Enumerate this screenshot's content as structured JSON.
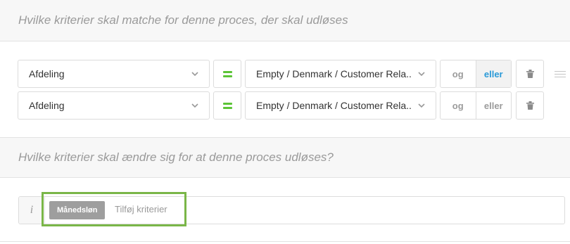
{
  "section_match": {
    "title": "Hvilke kriterier skal matche for denne proces, der skal udløses"
  },
  "rules": [
    {
      "field": "Afdeling",
      "operator": "=",
      "value": "Empty / Denmark / Customer Rela...",
      "and_label": "og",
      "or_label": "eller",
      "active": "eller"
    },
    {
      "field": "Afdeling",
      "operator": "=",
      "value": "Empty / Denmark / Customer Rela...",
      "and_label": "og",
      "or_label": "eller",
      "active": "none"
    }
  ],
  "section_change": {
    "title": "Hvilke kriterier skal ændre sig for at denne proces udløses?"
  },
  "criteria_bar": {
    "info_icon": "i",
    "tag_label": "Månedsløn",
    "add_label": "Tilføj kriterier"
  },
  "colors": {
    "accent_green": "#5cc437",
    "highlight_green": "#7ab648",
    "active_blue": "#2a9ad8"
  }
}
